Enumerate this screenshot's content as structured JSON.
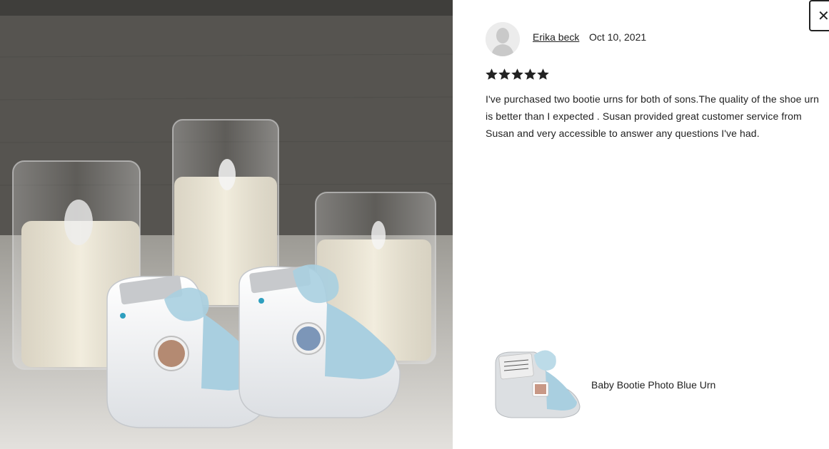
{
  "photo": {
    "description_icon": "review-photo"
  },
  "close": {
    "icon": "close-icon",
    "glyph": "✕"
  },
  "review": {
    "reviewer_name": "Erika beck",
    "date": "Oct 10, 2021",
    "rating": 5,
    "rating_max": 5,
    "text": "I've purchased two bootie urns for both of sons.The quality of the shoe urn is better than I expected . Susan provided great customer service from Susan and very accessible to answer any questions I've had."
  },
  "product": {
    "name": "Baby Bootie Photo Blue Urn"
  },
  "colors": {
    "star": "#222222",
    "text": "#222222",
    "bootie_blue": "#a9cfe0"
  }
}
